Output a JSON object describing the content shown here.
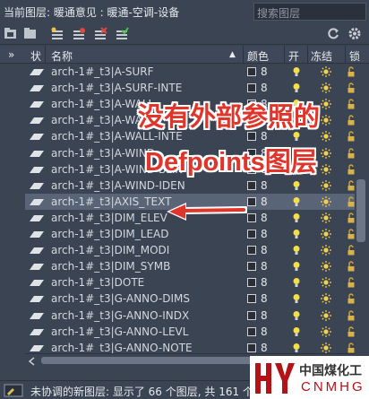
{
  "topbar": {
    "current_layer": "当前图层: 暖通意见 : 暖通-空调-设备",
    "search_placeholder": "搜索图层"
  },
  "toolbar": {
    "icons": [
      "new-layer-folder-icon",
      "layer-folder-icon",
      "new-layer-icon",
      "new-layer-vp-freeze-icon",
      "delete-layer-icon",
      "set-current-icon",
      "refresh-icon",
      "settings-icon"
    ]
  },
  "header": {
    "collapse": "»",
    "status": "状",
    "name": "名称",
    "sort": "▲",
    "color": "颜色",
    "on": "开",
    "freeze": "冻结",
    "lock": "锁"
  },
  "layers": [
    {
      "name": "arch-1#_t3|A-SURF",
      "color": "8"
    },
    {
      "name": "arch-1#_t3|A-SURF-INTE",
      "color": "8"
    },
    {
      "name": "arch-1#_t3|A-WALL",
      "color": "8"
    },
    {
      "name": "arch-1#_t3|A-WALL",
      "color": "8"
    },
    {
      "name": "arch-1#_t3|A-WALL-INTE",
      "color": "8"
    },
    {
      "name": "arch-1#_t3|A-WIND",
      "color": "8"
    },
    {
      "name": "arch-1#_t3|A-WIND-BLIN",
      "color": "8"
    },
    {
      "name": "arch-1#_t3|A-WIND-IDEN",
      "color": "8"
    },
    {
      "name": "arch-1#_t3|AXIS_TEXT",
      "color": "8",
      "selected": true
    },
    {
      "name": "arch-1#_t3|DIM_ELEV",
      "color": "8"
    },
    {
      "name": "arch-1#_t3|DIM_LEAD",
      "color": "8"
    },
    {
      "name": "arch-1#_t3|DIM_MODI",
      "color": "8"
    },
    {
      "name": "arch-1#_t3|DIM_SYMB",
      "color": "8"
    },
    {
      "name": "arch-1#_t3|DOTE",
      "color": "8"
    },
    {
      "name": "arch-1#_t3|G-ANNO-DIMS",
      "color": "8"
    },
    {
      "name": "arch-1#_t3|G-ANNO-INDX",
      "color": "8"
    },
    {
      "name": "arch-1#_t3|G-ANNO-LEVL",
      "color": "8"
    },
    {
      "name": "arch-1#_t3|G-ANNO-NOTE",
      "color": "8"
    }
  ],
  "statusbar": {
    "text": "未协调的新图层: 显示了 66 个图层, 共 161 个"
  },
  "annotation": {
    "line1": "没有外部参照的",
    "line2": "Defpoints图层",
    "arrow_color": "#e0352b"
  },
  "watermark": {
    "cn": "中国煤化工",
    "en": "CNMHG"
  },
  "colors": {
    "panel_bg": "#3b4453",
    "selected_row": "#596577",
    "bulb": "#f2df4a",
    "sun": "#f2d04a"
  }
}
